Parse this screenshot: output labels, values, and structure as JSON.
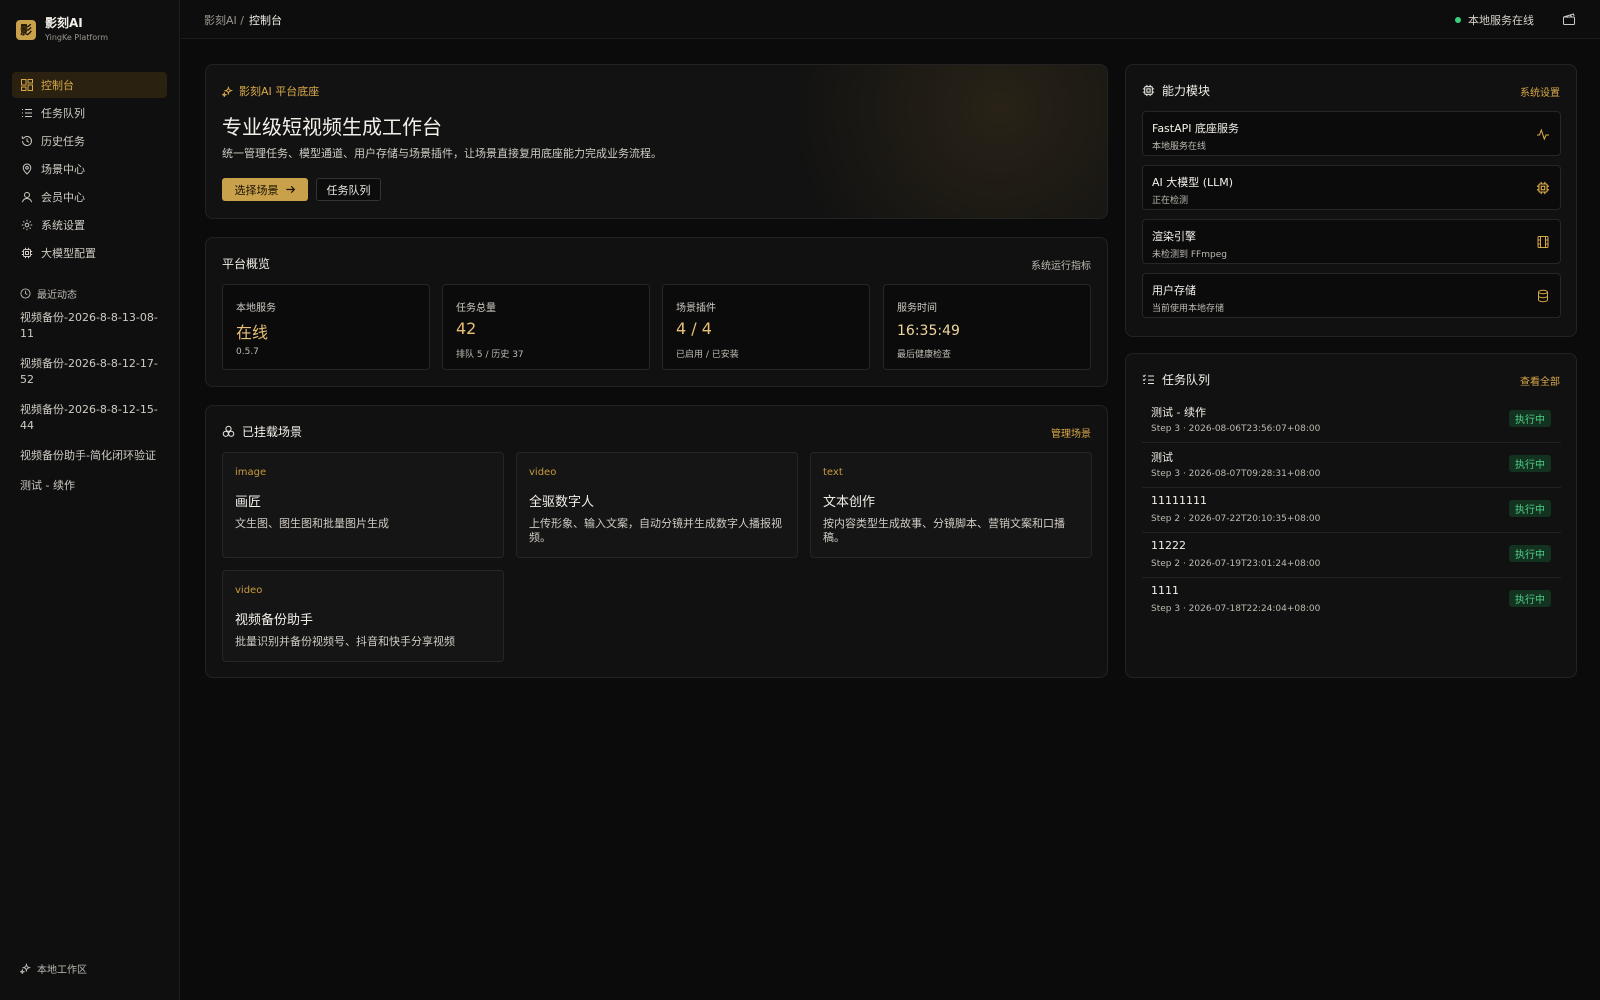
{
  "colors": {
    "accent": "#c9a14a",
    "accent_text": "#d9a949",
    "status_green": "#3ad07a",
    "background": "#0b0b0b"
  },
  "brand": {
    "logo_char": "影",
    "name": "影刻AI",
    "subtitle": "YingKe Platform"
  },
  "sidebar": {
    "items": [
      {
        "label": "控制台",
        "icon": "dashboard-icon",
        "active": true
      },
      {
        "label": "任务队列",
        "icon": "list-icon"
      },
      {
        "label": "历史任务",
        "icon": "history-icon"
      },
      {
        "label": "场景中心",
        "icon": "map-pin-icon"
      },
      {
        "label": "会员中心",
        "icon": "user-icon"
      },
      {
        "label": "系统设置",
        "icon": "gear-icon"
      },
      {
        "label": "大模型配置",
        "icon": "chip-icon"
      }
    ],
    "recent_title": "最近动态",
    "recent": [
      "视频备份-2026-8-8-13-08-11",
      "视频备份-2026-8-8-12-17-52",
      "视频备份-2026-8-8-12-15-44",
      "视频备份助手-简化闭环验证",
      "测试 - 续作"
    ],
    "footer": "本地工作区"
  },
  "topbar": {
    "breadcrumb_root": "影刻AI /",
    "breadcrumb_current": "控制台",
    "service_status": "本地服务在线"
  },
  "hero": {
    "tag": "影刻AI 平台底座",
    "title": "专业级短视频生成工作台",
    "desc": "统一管理任务、模型通道、用户存储与场景插件，让场景直接复用底座能力完成业务流程。",
    "primary_button": "选择场景",
    "secondary_button": "任务队列"
  },
  "overview": {
    "title": "平台概览",
    "link": "系统运行指标",
    "stats": [
      {
        "label": "本地服务",
        "value": "在线",
        "sub": "0.5.7"
      },
      {
        "label": "任务总量",
        "value": "42",
        "sub": "排队 5 / 历史 37"
      },
      {
        "label": "场景插件",
        "value": "4 / 4",
        "sub": "已启用 / 已安装"
      },
      {
        "label": "服务时间",
        "value": "16:35:49",
        "sub": "最后健康检查"
      }
    ]
  },
  "scenes": {
    "title": "已挂载场景",
    "link": "管理场景",
    "items": [
      {
        "kind": "image",
        "name": "画匠",
        "desc": "文生图、图生图和批量图片生成"
      },
      {
        "kind": "video",
        "name": "全驱数字人",
        "desc": "上传形象、输入文案，自动分镜并生成数字人播报视频。"
      },
      {
        "kind": "text",
        "name": "文本创作",
        "desc": "按内容类型生成故事、分镜脚本、营销文案和口播稿。"
      },
      {
        "kind": "video",
        "name": "视频备份助手",
        "desc": "批量识别并备份视频号、抖音和快手分享视频"
      }
    ]
  },
  "modules": {
    "title": "能力模块",
    "link": "系统设置",
    "items": [
      {
        "name": "FastAPI 底座服务",
        "sub": "本地服务在线",
        "icon": "activity-icon"
      },
      {
        "name": "AI 大模型 (LLM)",
        "sub": "正在检测",
        "icon": "chip-icon"
      },
      {
        "name": "渲染引擎",
        "sub": "未检测到 FFmpeg",
        "icon": "film-icon"
      },
      {
        "name": "用户存储",
        "sub": "当前使用本地存储",
        "icon": "database-icon"
      }
    ]
  },
  "queue": {
    "title": "任务队列",
    "link": "查看全部",
    "items": [
      {
        "name": "测试 - 续作",
        "sub": "Step 3 · 2026-08-06T23:56:07+08:00",
        "status": "执行中"
      },
      {
        "name": "测试",
        "sub": "Step 3 · 2026-08-07T09:28:31+08:00",
        "status": "执行中"
      },
      {
        "name": "11111111",
        "sub": "Step 2 · 2026-07-22T20:10:35+08:00",
        "status": "执行中"
      },
      {
        "name": "11222",
        "sub": "Step 2 · 2026-07-19T23:01:24+08:00",
        "status": "执行中"
      },
      {
        "name": "1111",
        "sub": "Step 3 · 2026-07-18T22:24:04+08:00",
        "status": "执行中"
      }
    ]
  }
}
